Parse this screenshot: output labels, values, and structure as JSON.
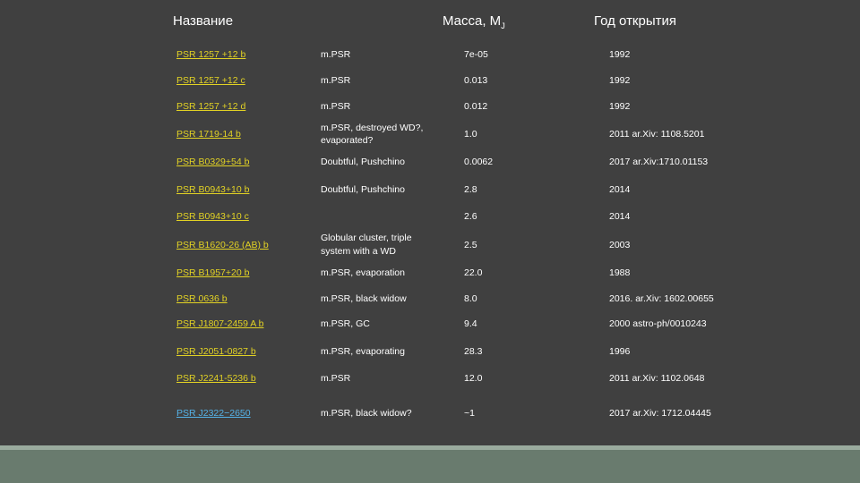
{
  "header": {
    "name": "Название",
    "mass": "Масса, M",
    "mass_sub": "J",
    "year": "Год открытия"
  },
  "rows": [
    {
      "name": "PSR 1257 +12 b",
      "type": "m.PSR",
      "mass": "7e-05",
      "year": "1992"
    },
    {
      "name": "PSR 1257 +12 c",
      "type": "m.PSR",
      "mass": "0.013",
      "year": "1992"
    },
    {
      "name": "PSR 1257 +12 d",
      "type": "m.PSR",
      "mass": "0.012",
      "year": "1992"
    },
    {
      "name": "PSR 1719-14 b",
      "type": "m.PSR, destroyed WD?, evaporated?",
      "mass": "1.0",
      "year": "2011 ar.Xiv: 1108.5201"
    },
    {
      "name": "PSR B0329+54 b",
      "type": "Doubtful, Pushchino",
      "mass": "0.0062",
      "year": "2017 ar.Xiv:1710.01153"
    },
    {
      "name": "PSR B0943+10 b",
      "type": "Doubtful, Pushchino",
      "mass": "2.8",
      "year": "2014"
    },
    {
      "name": "PSR B0943+10 c",
      "type": "",
      "mass": "2.6",
      "year": "2014"
    },
    {
      "name": "PSR B1620-26 (AB) b",
      "type": "Globular cluster, triple system with a WD",
      "mass": "2.5",
      "year": "2003"
    },
    {
      "name": "PSR B1957+20 b",
      "type": "m.PSR, evaporation",
      "mass": "22.0",
      "year": "1988"
    },
    {
      "name": "PSR 0636 b",
      "type": "m.PSR, black widow",
      "mass": "8.0",
      "year": "2016. ar.Xiv: 1602.00655"
    },
    {
      "name": "PSR J1807-2459 A b",
      "type": "m.PSR, GC",
      "mass": "9.4",
      "year": "2000 astro-ph/0010243"
    },
    {
      "name": "PSR J2051-0827 b",
      "type": "m.PSR, evaporating",
      "mass": "28.3",
      "year": "1996"
    },
    {
      "name": "PSR J2241-5236 b",
      "type": "m.PSR",
      "mass": "12.0",
      "year": "2011 ar.Xiv: 1102.0648"
    },
    {
      "name": "PSR J2322−2650",
      "type": "m.PSR, black widow?",
      "mass": "~1",
      "year": "2017 ar.Xiv: 1712.04445"
    }
  ],
  "colors": {
    "background": "#404040",
    "link": "#e2d224",
    "link_visited": "#55b3e8",
    "footer": "#697b6e"
  }
}
